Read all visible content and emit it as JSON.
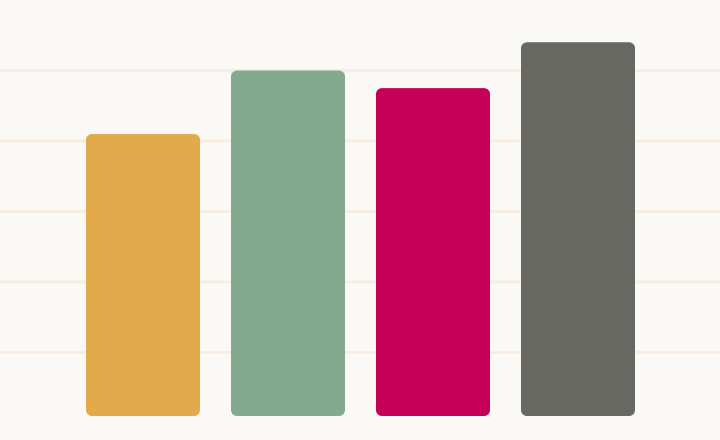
{
  "chart_data": {
    "type": "bar",
    "categories": [
      "",
      "",
      "",
      ""
    ],
    "values": [
      4.1,
      5.0,
      4.75,
      5.4
    ],
    "colors": [
      "#e2aa4b",
      "#83aa8e",
      "#c40058",
      "#676862"
    ],
    "ylim": [
      0,
      6
    ],
    "grid": true,
    "gridline_values": [
      1,
      2,
      3,
      4,
      5
    ],
    "background": "#fbf9f5",
    "grid_color": "#f8ede0"
  }
}
